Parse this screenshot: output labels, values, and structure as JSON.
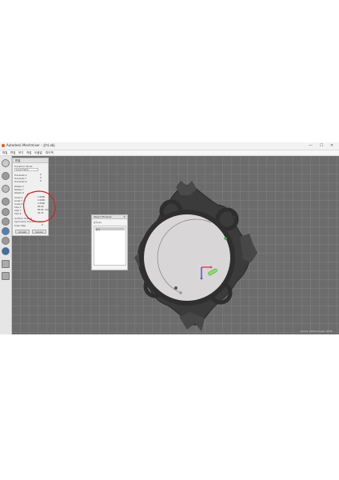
{
  "window": {
    "title": "Autodesk Meshmixer - 상자.obj",
    "minimize": "—",
    "maximize": "☐",
    "close": "✕"
  },
  "menu": [
    "파일",
    "편집",
    "보기",
    "작업",
    "도움말",
    "피드백"
  ],
  "toolbar": {
    "tools": [
      "plus-icon",
      "import-icon",
      "meshmix-icon",
      "select-icon",
      "sculpt-icon",
      "stamp-icon",
      "edit-icon",
      "analysis-icon",
      "shaders-icon",
      "export-icon",
      "print-icon"
    ]
  },
  "edit_panel": {
    "title": "편집",
    "mode_label": "Transform Mode",
    "mode_value": "Local Frame",
    "translate": [
      {
        "label": "Translate X",
        "value": "0"
      },
      {
        "label": "Translate Y",
        "value": "0"
      },
      {
        "label": "Translate Z",
        "value": "0"
      }
    ],
    "rotate": [
      {
        "label": "Rotate X",
        "value": ""
      },
      {
        "label": "Rotate Y",
        "value": ""
      },
      {
        "label": "Rotate Z",
        "value": ""
      }
    ],
    "scale_size": [
      {
        "label": "Scale X",
        "value": "1.0000"
      },
      {
        "label": "Scale Y",
        "value": "1.0000"
      },
      {
        "label": "Scale Z",
        "value": "1.0000"
      },
      {
        "label": "Size X",
        "value": "80.00"
      },
      {
        "label": "Size Y",
        "value": "80.00"
      },
      {
        "label": "Size Z",
        "value": "24.15"
      }
    ],
    "units": "mm",
    "uniform_scaling": "Uniform Scaling",
    "symmetric_editing": "Symmetric Transformation",
    "snap_label": "Snap Step",
    "snap_value": "0",
    "accept": "Accept",
    "cancel": "Cancel"
  },
  "object_browser": {
    "title": "Object Browser",
    "close": "✕",
    "header": "상자.obj",
    "items": [
      "상자"
    ]
  },
  "status": "vertices: 44160  triangles: 88316",
  "colors": {
    "viewport": "#6c6c6c",
    "annotation_circle": "#d42020",
    "gizmo_red": "#d45858",
    "gizmo_green": "#3fa845",
    "gizmo_blue": "#5a5ad8"
  }
}
